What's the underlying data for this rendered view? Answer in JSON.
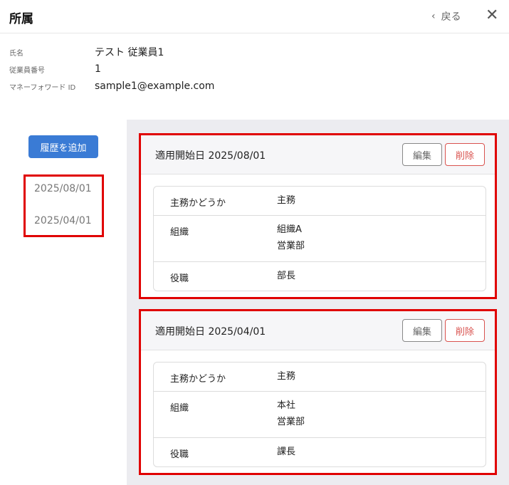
{
  "header": {
    "title": "所属",
    "back_label": "戻る",
    "back_icon": "chevron-left-icon",
    "close_icon": "close-icon"
  },
  "employee": {
    "name_label": "氏名",
    "name_value": "テスト 従業員1",
    "number_label": "従業員番号",
    "number_value": "1",
    "mf_id_label": "マネーフォワード ID",
    "mf_id_value": "sample1@example.com"
  },
  "actions": {
    "add_history_label": "履歴を追加"
  },
  "history_dates": [
    "2025/08/01",
    "2025/04/01"
  ],
  "history": [
    {
      "title": "適用開始日 2025/08/01",
      "edit_label": "編集",
      "delete_label": "削除",
      "rows": {
        "main_label": "主務かどうか",
        "main_value": "主務",
        "org_label": "組織",
        "org_line1": "組織A",
        "org_line2": "営業部",
        "position_label": "役職",
        "position_value": "部長"
      }
    },
    {
      "title": "適用開始日 2025/04/01",
      "edit_label": "編集",
      "delete_label": "削除",
      "rows": {
        "main_label": "主務かどうか",
        "main_value": "主務",
        "org_label": "組織",
        "org_line1": "本社",
        "org_line2": "営業部",
        "position_label": "役職",
        "position_value": "課長"
      }
    }
  ],
  "colors": {
    "primary_button": "#3a7bd5",
    "highlight_outline": "#e00000",
    "delete_text": "#d9534f",
    "panel_background": "#ececf0"
  }
}
